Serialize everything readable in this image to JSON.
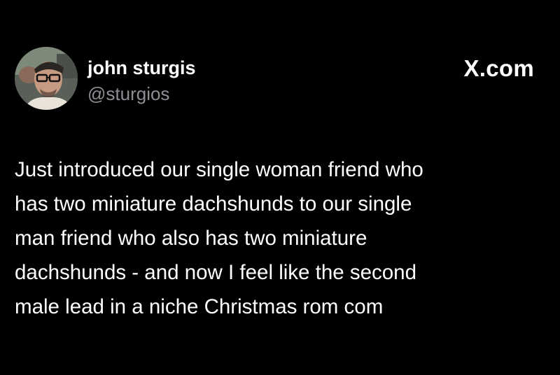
{
  "author": {
    "name": "john sturgis",
    "handle": "@sturgios",
    "avatar_icon": "profile-photo-avatar"
  },
  "site": {
    "label": "X.com"
  },
  "tweet": {
    "lines": [
      "Just introduced our single woman friend who",
      "has two miniature dachshunds to our single",
      "man friend who also has two miniature",
      "dachshunds - and now I feel like the second",
      "male lead in a niche Christmas rom com"
    ]
  },
  "colors": {
    "background": "#000000",
    "text": "#ffffff",
    "handle": "#8b8f94"
  }
}
